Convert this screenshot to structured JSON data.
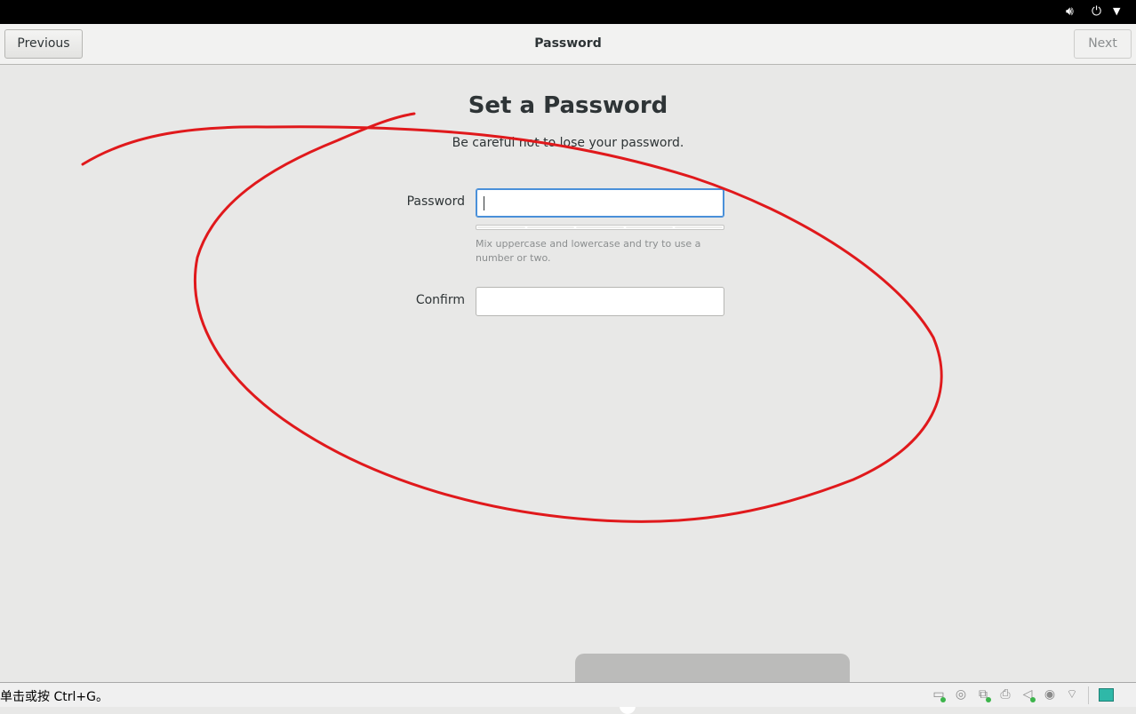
{
  "system_bar": {
    "volume_icon": "speaker-icon",
    "power_icon": "power-icon",
    "menu_icon": "dropdown-arrow-icon"
  },
  "header": {
    "previous_label": "Previous",
    "title": "Password",
    "next_label": "Next"
  },
  "page": {
    "heading": "Set a Password",
    "subheading": "Be careful not to lose your password.",
    "password_label": "Password",
    "password_value": "",
    "strength_hint": "Mix uppercase and lowercase and try to use a number or two.",
    "strength_level": 0,
    "confirm_label": "Confirm",
    "confirm_value": ""
  },
  "annotation": {
    "color": "#e0191c"
  },
  "statusbar": {
    "text": "单击或按 Ctrl+G。",
    "icons": [
      "hard-disk-icon",
      "optical-disc-icon",
      "network-icon",
      "printer-icon",
      "sound-muted-icon",
      "usb-icon",
      "wireless-icon",
      "message-icon"
    ]
  },
  "colors": {
    "focus": "#4a90d9",
    "background": "#e8e8e7"
  }
}
